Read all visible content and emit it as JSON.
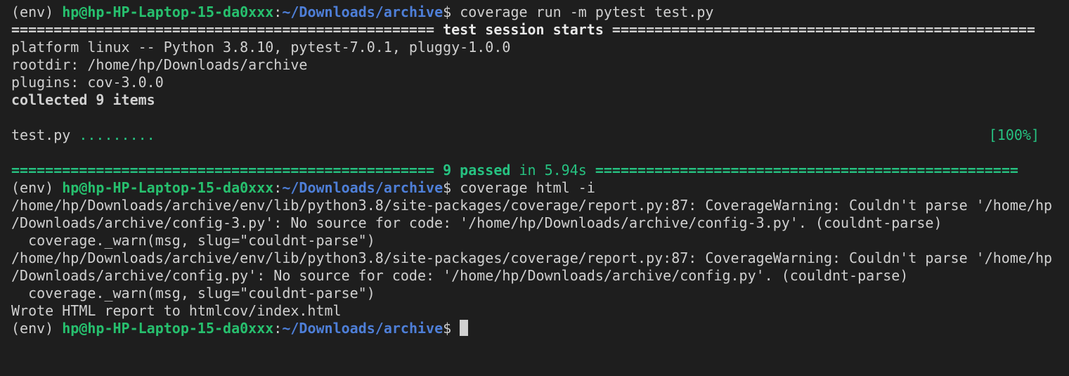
{
  "colors": {
    "background": "#1e1e1e",
    "text": "#d0d0d0",
    "user_host": "#27c06e",
    "path": "#4e7fd8",
    "pass_green": "#26c281"
  },
  "prompt": {
    "env": "(env) ",
    "user_host": "hp@hp-HP-Laptop-15-da0xxx",
    "colon": ":",
    "path": "~/Downloads/archive",
    "dollar": "$ "
  },
  "commands": {
    "first": "coverage run -m pytest test.py",
    "second": "coverage html -i",
    "third": ""
  },
  "session": {
    "header_left_equals": "================================================== ",
    "header_title": "test session starts",
    "header_right_equals": " ==================================================",
    "platform": "platform linux -- Python 3.8.10, pytest-7.0.1, pluggy-1.0.0",
    "rootdir": "rootdir: /home/hp/Downloads/archive",
    "plugins": "plugins: cov-3.0.0",
    "collected": "collected 9 items",
    "test_file": "test.py ",
    "test_dots": ".........",
    "progress": "[100%]",
    "summary_left_equals": "================================================== ",
    "summary_passed": "9 passed",
    "summary_time": " in 5.94s ",
    "summary_right_equals": "=================================================="
  },
  "output": {
    "warning1_line1": "/home/hp/Downloads/archive/env/lib/python3.8/site-packages/coverage/report.py:87: CoverageWarning: Couldn't parse '/home/hp",
    "warning1_line2": "/Downloads/archive/config-3.py': No source for code: '/home/hp/Downloads/archive/config-3.py'. (couldnt-parse)",
    "warning1_line3": "  coverage._warn(msg, slug=\"couldnt-parse\")",
    "warning2_line1": "/home/hp/Downloads/archive/env/lib/python3.8/site-packages/coverage/report.py:87: CoverageWarning: Couldn't parse '/home/hp",
    "warning2_line2": "/Downloads/archive/config.py': No source for code: '/home/hp/Downloads/archive/config.py'. (couldnt-parse)",
    "warning2_line3": "  coverage._warn(msg, slug=\"couldnt-parse\")",
    "wrote": "Wrote HTML report to htmlcov/index.html"
  }
}
